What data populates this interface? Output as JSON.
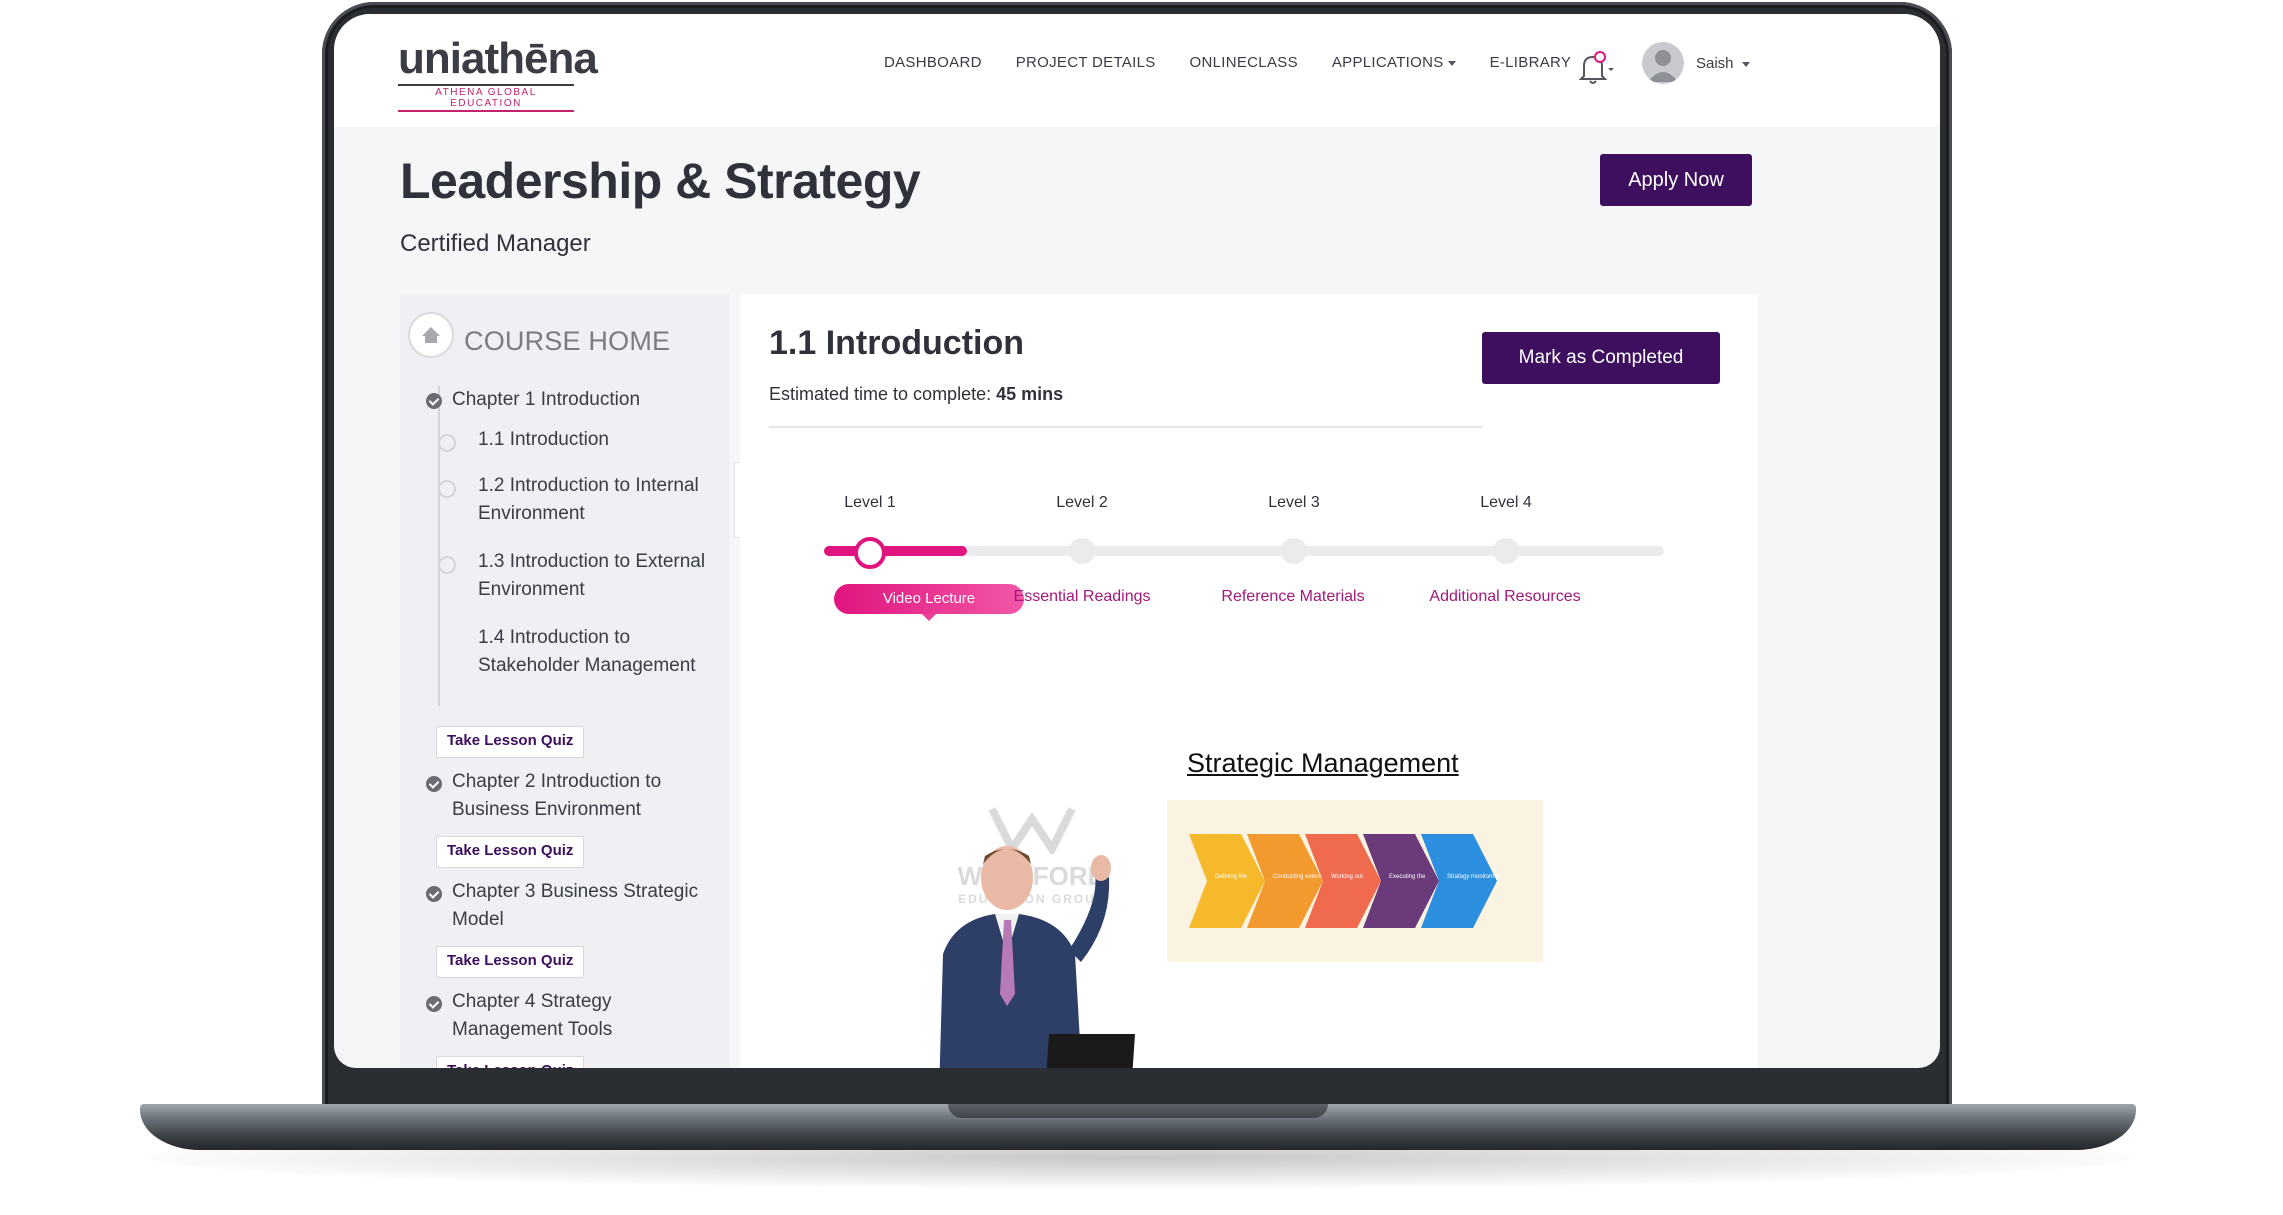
{
  "logo": {
    "word_uni": "uni",
    "word_athena": "athēna",
    "tagline": "ATHENA GLOBAL EDUCATION"
  },
  "nav": {
    "items": [
      "DASHBOARD",
      "PROJECT DETAILS",
      "ONLINECLASS",
      "APPLICATIONS",
      "E-LIBRARY"
    ],
    "user_name": "Saish"
  },
  "course": {
    "title": "Leadership & Strategy",
    "subtitle": "Certified Manager",
    "apply_label": "Apply Now"
  },
  "sidebar": {
    "home_label": "COURSE HOME",
    "chapters": [
      {
        "title_line1": "Chapter 1 Introduction",
        "title_line2": ""
      },
      {
        "title_line1": "Chapter 2 Introduction to",
        "title_line2": "Business Environment"
      },
      {
        "title_line1": "Chapter 3 Business Strategic",
        "title_line2": "Model"
      },
      {
        "title_line1": "Chapter 4 Strategy",
        "title_line2": "Management Tools"
      }
    ],
    "lessons": [
      {
        "line1": "1.1 Introduction",
        "line2": ""
      },
      {
        "line1": "1.2 Introduction to Internal",
        "line2": "Environment"
      },
      {
        "line1": "1.3 Introduction to External",
        "line2": "Environment"
      },
      {
        "line1": "1.4 Introduction to",
        "line2": "Stakeholder Management"
      }
    ],
    "quiz_label": "Take Lesson Quiz",
    "collapse_glyph": "≪"
  },
  "lesson": {
    "title": "1.1 Introduction",
    "time_prefix": "Estimated time to complete: ",
    "time_value": "45 mins",
    "complete_label": "Mark as Completed"
  },
  "levels": {
    "labels": [
      "Level 1",
      "Level 2",
      "Level 3",
      "Level 4"
    ],
    "resources": [
      "Video Lecture",
      "Essential Readings",
      "Reference Materials",
      "Additional Resources"
    ],
    "active_index": 0,
    "progress_fraction": 0.17
  },
  "video": {
    "slide_title": "Strategic Management",
    "watermark": "WESTFORD",
    "watermark_sub": "EDUCATION GROUP",
    "steps": [
      "Defining the mission and objectives",
      "Conducting external & internal analysis",
      "Working out a strategic plan",
      "Executing the strategy",
      "Strategy monitoring"
    ]
  },
  "colors": {
    "primary": "#3d0f5e",
    "accent": "#e0147f",
    "step_colors": [
      "#f6b92b",
      "#f39a2e",
      "#f06a4e",
      "#6a3a7a",
      "#2d8fe0"
    ]
  }
}
